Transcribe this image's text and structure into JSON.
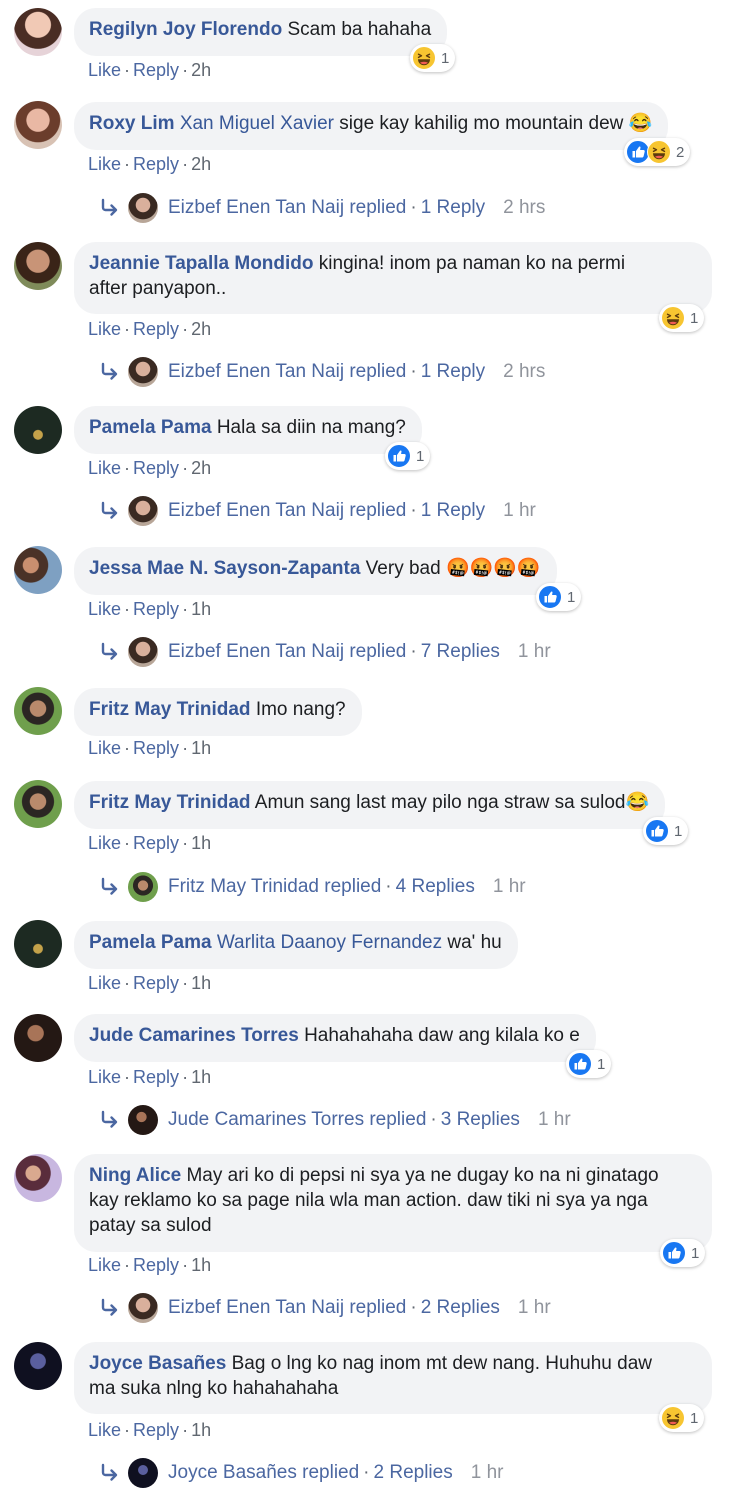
{
  "actions": {
    "like": "Like",
    "reply": "Reply",
    "dot": "·"
  },
  "colors": {
    "link": "#385898",
    "bubble": "#f2f3f5",
    "like_blue": "#1877f2",
    "haha_yellow": "#f7b125"
  },
  "comments": [
    {
      "author": "Regilyn Joy Florendo",
      "tag": "",
      "text": "Scam ba hahaha",
      "time": "2h",
      "reactions": {
        "icons": [
          "haha-icon"
        ],
        "count": "1"
      }
    },
    {
      "author": "Roxy Lim",
      "tag": "Xan Miguel Xavier",
      "text": "sige kay kahilig mo mountain dew 😂",
      "time": "2h",
      "reactions": {
        "icons": [
          "like-icon",
          "haha-icon"
        ],
        "count": "2"
      },
      "reply": {
        "name": "Eizbef Enen Tan Naij replied",
        "count": "1 Reply",
        "time": "2 hrs"
      }
    },
    {
      "author": "Jeannie Tapalla Mondido",
      "tag": "",
      "text_lines": [
        "kingina! inom pa naman ko na permi",
        "after panyapon.."
      ],
      "time": "2h",
      "reactions": {
        "icons": [
          "haha-icon"
        ],
        "count": "1"
      },
      "reply": {
        "name": "Eizbef Enen Tan Naij replied",
        "count": "1 Reply",
        "time": "2 hrs"
      }
    },
    {
      "author": "Pamela Pama",
      "tag": "",
      "text": "Hala sa diin na mang?",
      "time": "2h",
      "reactions": {
        "icons": [
          "like-icon"
        ],
        "count": "1"
      },
      "reply": {
        "name": "Eizbef Enen Tan Naij replied",
        "count": "1 Reply",
        "time": "1 hr"
      }
    },
    {
      "author": "Jessa Mae N. Sayson-Zapanta",
      "tag": "",
      "text": "Very bad 🤬🤬🤬🤬",
      "time": "1h",
      "reactions": {
        "icons": [
          "like-icon"
        ],
        "count": "1"
      },
      "reply": {
        "name": "Eizbef Enen Tan Naij replied",
        "count": "7 Replies",
        "time": "1 hr"
      }
    },
    {
      "author": "Fritz May Trinidad",
      "tag": "",
      "text": "Imo nang?",
      "time": "1h"
    },
    {
      "author": "Fritz May Trinidad",
      "tag": "",
      "text": "Amun sang last may pilo nga straw sa sulod😂",
      "time": "1h",
      "reactions": {
        "icons": [
          "like-icon"
        ],
        "count": "1"
      },
      "reply": {
        "name": "Fritz May Trinidad replied",
        "count": "4 Replies",
        "time": "1 hr"
      }
    },
    {
      "author": "Pamela Pama",
      "tag": "Warlita Daanoy Fernandez",
      "text": "wa' hu",
      "time": "1h"
    },
    {
      "author": "Jude Camarines Torres",
      "tag": "",
      "text": "Hahahahaha daw ang kilala ko e",
      "time": "1h",
      "reactions": {
        "icons": [
          "like-icon"
        ],
        "count": "1"
      },
      "reply": {
        "name": "Jude Camarines Torres replied",
        "count": "3 Replies",
        "time": "1 hr"
      }
    },
    {
      "author": "Ning Alice",
      "tag": "",
      "text_lines": [
        "May ari ko di pepsi ni sya ya ne dugay ko na ni ginatago",
        "kay reklamo ko sa page nila wla man action. daw tiki ni sya ya nga",
        "patay sa sulod"
      ],
      "time": "1h",
      "reactions": {
        "icons": [
          "like-icon"
        ],
        "count": "1"
      },
      "reply": {
        "name": "Eizbef Enen Tan Naij replied",
        "count": "2 Replies",
        "time": "1 hr"
      }
    },
    {
      "author": "Joyce Basañes",
      "tag": "",
      "text_lines": [
        "Bag o lng ko nag inom mt dew nang. Huhuhu daw",
        "ma suka nlng ko hahahahaha"
      ],
      "time": "1h",
      "reactions": {
        "icons": [
          "haha-icon"
        ],
        "count": "1"
      },
      "reply": {
        "name": "Joyce Basañes replied",
        "count": "2 Replies",
        "time": "1 hr"
      }
    }
  ]
}
